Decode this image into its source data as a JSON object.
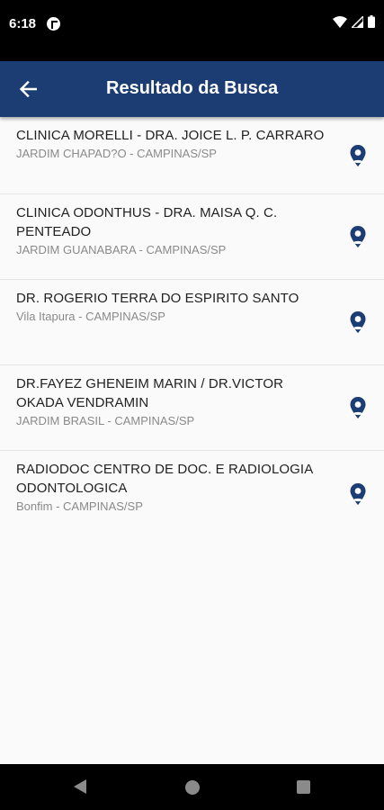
{
  "status_bar": {
    "time": "6:18"
  },
  "app_bar": {
    "title": "Resultado da Busca"
  },
  "results": [
    {
      "name": "CLINICA MORELLI - DRA. JOICE L. P. CARRARO",
      "address": "JARDIM CHAPAD?O - CAMPINAS/SP"
    },
    {
      "name": "CLINICA ODONTHUS - DRA. MAISA Q. C. PENTEADO",
      "address": "JARDIM GUANABARA - CAMPINAS/SP"
    },
    {
      "name": "DR. ROGERIO TERRA DO ESPIRITO SANTO",
      "address": "Vila Itapura - CAMPINAS/SP"
    },
    {
      "name": "DR.FAYEZ GHENEIM MARIN / DR.VICTOR OKADA VENDRAMIN",
      "address": "JARDIM BRASIL - CAMPINAS/SP"
    },
    {
      "name": "RADIODOC CENTRO DE DOC. E RADIOLOGIA ODONTOLOGICA",
      "address": "Bonfim - CAMPINAS/SP"
    }
  ],
  "colors": {
    "app_bar": "#1c3d74",
    "pin": "#1c3d74"
  },
  "icons": {
    "back": "arrow-left-icon",
    "pin": "map-pin-icon"
  }
}
